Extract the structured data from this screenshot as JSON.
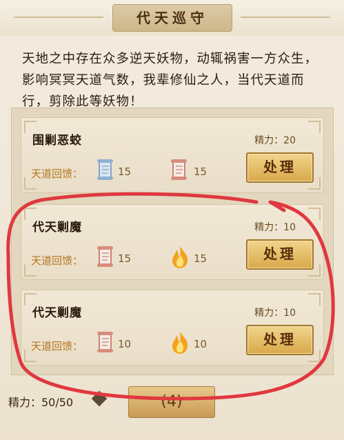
{
  "header": {
    "title": "代天巡守"
  },
  "intro": {
    "text": "天地之中存在众多逆天妖物，动辄祸害一方众生，影响冥冥天道气数，我辈修仙之人，当代天道而行，剪除此等妖物！"
  },
  "tasks": [
    {
      "name": "围剿恶蛟",
      "energy": "精力：20",
      "reward_label": "天道回馈：",
      "rewards": [
        {
          "icon": "blue-scroll-icon",
          "value": "15"
        },
        {
          "icon": "red-scroll-icon",
          "value": "15"
        }
      ],
      "button": "处理"
    },
    {
      "name": "代天剿魔",
      "energy": "精力：10",
      "reward_label": "天道回馈：",
      "rewards": [
        {
          "icon": "red-scroll-icon",
          "value": "15"
        },
        {
          "icon": "flame-icon",
          "value": "15"
        }
      ],
      "button": "处理"
    },
    {
      "name": "代天剿魔",
      "energy": "精力：10",
      "reward_label": "天道回馈：",
      "rewards": [
        {
          "icon": "red-scroll-icon",
          "value": "10"
        },
        {
          "icon": "flame-icon",
          "value": "10"
        }
      ],
      "button": "处理"
    }
  ],
  "footer": {
    "energy": "精力：50/50",
    "button": "(4)"
  },
  "colors": {
    "annotation_stroke": "#e0383f",
    "button_gold": "#d8a84a"
  }
}
